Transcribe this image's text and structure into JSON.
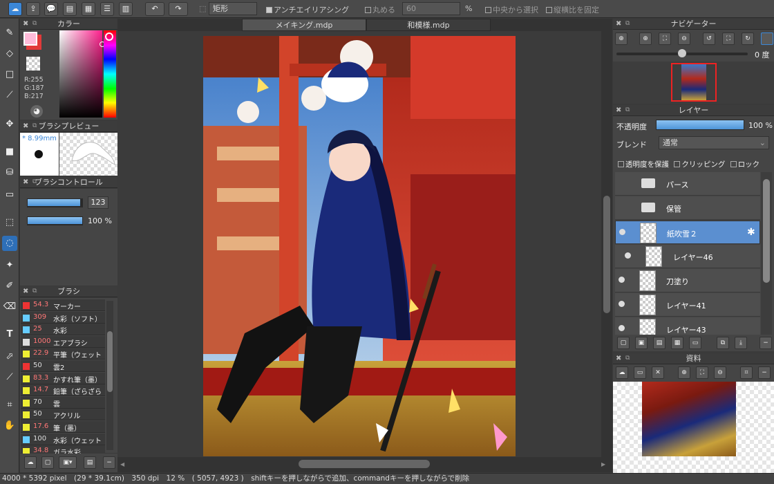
{
  "toolbar": {
    "shape_select": "矩形",
    "antialias_label": "アンチエイリアシング",
    "round_label": "丸める",
    "round_value": "60",
    "percent_label": "%",
    "center_select_label": "中央から選択",
    "fix_ratio_label": "縦横比を固定"
  },
  "panels": {
    "color": "カラー",
    "brush_preview": "ブラシプレビュー",
    "brush_control": "ブラシコントロール",
    "brush": "ブラシ",
    "navigator": "ナビゲーター",
    "layer": "レイヤー",
    "material": "資料"
  },
  "color": {
    "r": "R:255",
    "g": "G:187",
    "b": "B:217",
    "primary": "#ffbbd9",
    "secondary": "#e23a3a"
  },
  "brush_preview": {
    "size": "* 8.99mm"
  },
  "brush_control": {
    "size_value": "123",
    "opacity_value": "100 %",
    "size_fraction": 0.96,
    "opacity_fraction": 1.0
  },
  "brushes": [
    {
      "size": "54.3",
      "name": "マーカー",
      "color": "#e33",
      "size_color": "#f77"
    },
    {
      "size": "309",
      "name": "水彩（ソフト）",
      "color": "#6cf",
      "size_color": "#f77"
    },
    {
      "size": "25",
      "name": "水彩",
      "color": "#6cf",
      "size_color": "#f77"
    },
    {
      "size": "1000",
      "name": "エアブラシ",
      "color": "#ddd",
      "size_color": "#f77"
    },
    {
      "size": "22.9",
      "name": "平筆（ウェット",
      "color": "#ee3",
      "size_color": "#f77"
    },
    {
      "size": "50",
      "name": "雲2",
      "color": "#e33",
      "size_color": "#ddd"
    },
    {
      "size": "83.3",
      "name": "かすれ筆（墨）",
      "color": "#ee3",
      "size_color": "#f77"
    },
    {
      "size": "14.7",
      "name": "鉛筆（ざらざら",
      "color": "#ee3",
      "size_color": "#f77"
    },
    {
      "size": "70",
      "name": "雲",
      "color": "#ee3",
      "size_color": "#ddd"
    },
    {
      "size": "50",
      "name": "アクリル",
      "color": "#ee3",
      "size_color": "#ddd"
    },
    {
      "size": "17.6",
      "name": "筆（墨）",
      "color": "#ee3",
      "size_color": "#f77"
    },
    {
      "size": "100",
      "name": "水彩（ウェット",
      "color": "#6cf",
      "size_color": "#ddd"
    },
    {
      "size": "34.8",
      "name": "ガラ水彩",
      "color": "#ee3",
      "size_color": "#f77"
    }
  ],
  "tabs": [
    {
      "label": "メイキング.mdp",
      "active": true
    },
    {
      "label": "和模様.mdp",
      "active": false
    }
  ],
  "navigator": {
    "angle": "0 度",
    "zoom_fraction": 0.5
  },
  "layer_panel": {
    "opacity_label": "不透明度",
    "opacity_value": "100 %",
    "blend_label": "ブレンド",
    "blend_value": "通常",
    "protect_alpha": "透明度を保護",
    "clipping": "クリッピング",
    "lock": "ロック"
  },
  "layers": [
    {
      "name": "パース",
      "type": "folder"
    },
    {
      "name": "保管",
      "type": "folder"
    },
    {
      "name": "紙吹雪２",
      "type": "layer",
      "selected": true
    },
    {
      "name": "レイヤー46",
      "type": "layer",
      "indent": true
    },
    {
      "name": "刀塗り",
      "type": "layer"
    },
    {
      "name": "レイヤー41",
      "type": "layer"
    },
    {
      "name": "レイヤー43",
      "type": "layer"
    }
  ],
  "status": {
    "text": "4000 * 5392 pixel　(29 * 39.1cm)　350 dpi　12 %　( 5057, 4923 )　shiftキーを押しながらで追加、commandキーを押しながらで削除"
  }
}
